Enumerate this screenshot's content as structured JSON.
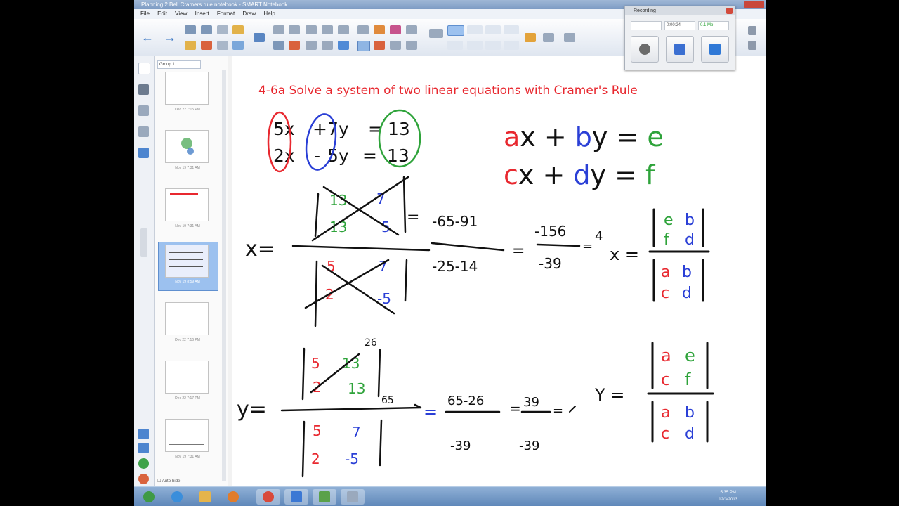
{
  "window": {
    "title": "Planning 2 Bell Cramers rule.notebook - SMART Notebook",
    "menus": [
      "File",
      "Edit",
      "View",
      "Insert",
      "Format",
      "Draw",
      "Help"
    ]
  },
  "sorter": {
    "group_label": "Group 1",
    "slides": [
      {
        "caption": "Dec 22 7:15 PM"
      },
      {
        "caption": "Nov 19 7:31 AM"
      },
      {
        "caption": "Nov 19 7:31 AM"
      },
      {
        "caption": "Nov 19 8:59 AM"
      },
      {
        "caption": "Dec 22 7:16 PM"
      },
      {
        "caption": "Dec 22 7:17 PM"
      },
      {
        "caption": "Nov 19 7:31 AM"
      }
    ],
    "auto_hide_label": "Auto-hide"
  },
  "recorder": {
    "title": "Recording",
    "field_time": "0:00:24",
    "field_size": "0.1 Mb",
    "colors": {
      "record": "#6b6b6b",
      "pause": "#3b6fd1",
      "stop": "#2f78d6"
    }
  },
  "slide": {
    "title": "4-6a Solve a system of two linear equations with Cramer's Rule",
    "eq1_coef1": "5x",
    "eq1_op": "+",
    "eq1_coef2": "7y",
    "eq1_eq": "=",
    "eq1_rhs": "13",
    "eq2_coef1": "2x",
    "eq2_op": "-",
    "eq2_coef2": "5y",
    "eq2_eq": "=",
    "eq2_rhs": "13",
    "general1": {
      "a": "a",
      "x": "x + ",
      "b": "b",
      "y": "y = ",
      "e": "e"
    },
    "general2": {
      "c": "c",
      "x": "x + ",
      "d": "d",
      "y": "y = ",
      "f": "f"
    },
    "x_label": "x=",
    "x_num_tl": "13",
    "x_num_tr": "7",
    "x_num_bl": "13",
    "x_num_br": "5",
    "x_den_tl": "5",
    "x_den_tr": "7",
    "x_den_bl": "2",
    "x_den_br": "-5",
    "x_step1_num": "-65-91",
    "x_step1_den": "-25-14",
    "x_step2_num": "-156",
    "x_step2_den": "-39",
    "x_result": "4",
    "x_small_eq1": "=",
    "x_small_eq2": "=",
    "x_small_eq3": "=",
    "x_rule_label": "x =",
    "x_rule_num": {
      "tl": "e",
      "tr": "b",
      "bl": "f",
      "br": "d"
    },
    "x_rule_den": {
      "tl": "a",
      "tr": "b",
      "bl": "c",
      "br": "d"
    },
    "y_label": "y=",
    "y_num_tl": "5",
    "y_num_tr": "13",
    "y_num_bl": "2",
    "y_num_br": "13",
    "y_num_side_top": "26",
    "y_num_side_bot": "65",
    "y_den_tl": "5",
    "y_den_tr": "7",
    "y_den_bl": "2",
    "y_den_br": "-5",
    "y_eq_blue": "=",
    "y_step1_num": "65-26",
    "y_step1_den": "-39",
    "y_step2_num": "39",
    "y_step2_den": "-39",
    "y_eq2": "=",
    "y_eq3": "=",
    "y_rule_label": "Y =",
    "y_rule_num": {
      "tl": "a",
      "tr": "e",
      "bl": "c",
      "br": "f"
    },
    "y_rule_den": {
      "tl": "a",
      "tr": "b",
      "bl": "c",
      "br": "d"
    },
    "colors": {
      "red": "#e8282f",
      "blue": "#2a3fd6",
      "green": "#2ea33a",
      "black": "#111111",
      "title": "#e8282f"
    }
  },
  "taskbar": {
    "time": "5:35 PM",
    "date": "12/3/2013"
  }
}
